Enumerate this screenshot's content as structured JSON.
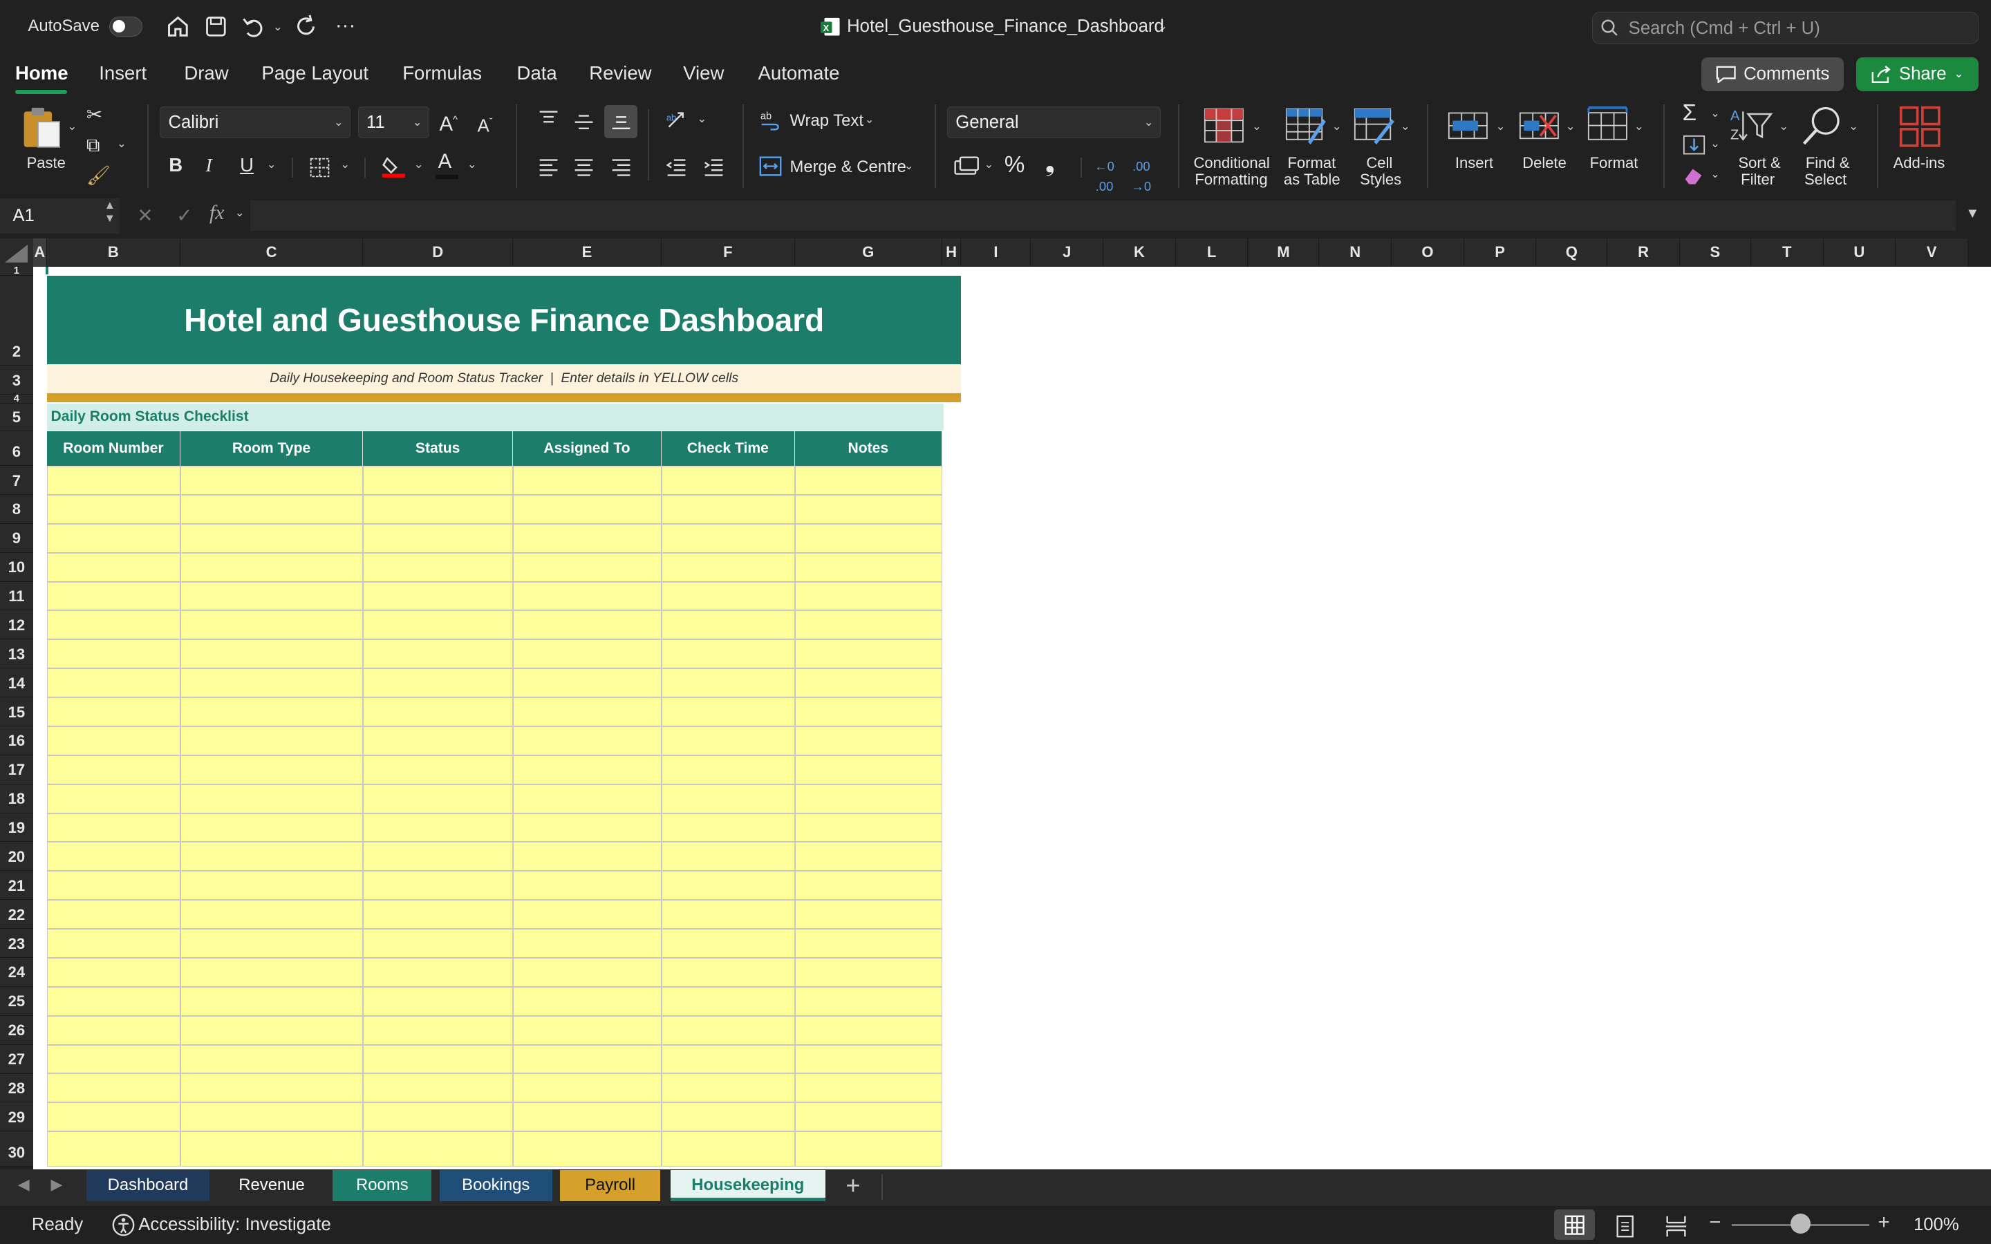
{
  "titlebar": {
    "autosave_label": "AutoSave",
    "autosave_on": false,
    "doc_title": "Hotel_Guesthouse_Finance_Dashboard",
    "search_placeholder": "Search (Cmd + Ctrl + U)"
  },
  "menu": {
    "tabs": [
      "Home",
      "Insert",
      "Draw",
      "Page Layout",
      "Formulas",
      "Data",
      "Review",
      "View",
      "Automate"
    ],
    "active": "Home",
    "comments_label": "Comments",
    "share_label": "Share"
  },
  "ribbon": {
    "paste_label": "Paste",
    "font_name": "Calibri",
    "font_size": "11",
    "wrap_text_label": "Wrap Text",
    "merge_label": "Merge & Centre",
    "number_format": "General",
    "conditional_formatting": [
      "Conditional",
      "Formatting"
    ],
    "format_as_table": [
      "Format",
      "as Table"
    ],
    "cell_styles": [
      "Cell",
      "Styles"
    ],
    "insert_label": "Insert",
    "delete_label": "Delete",
    "format_label": "Format",
    "sort_filter": [
      "Sort &",
      "Filter"
    ],
    "find_select": [
      "Find &",
      "Select"
    ],
    "addins_label": "Add-ins",
    "font_color": "#e00000",
    "fill_color": "#ff0000"
  },
  "formula_bar": {
    "name_box": "A1",
    "fx_label": "fx",
    "formula": ""
  },
  "grid": {
    "columns": [
      "A",
      "B",
      "C",
      "D",
      "E",
      "F",
      "G",
      "H",
      "I",
      "J",
      "K",
      "L",
      "M",
      "N",
      "O",
      "P",
      "Q",
      "R",
      "S",
      "T",
      "U",
      "V"
    ],
    "rows": [
      "1",
      "2",
      "3",
      "4",
      "5",
      "6",
      "7",
      "8",
      "9",
      "10",
      "11",
      "12",
      "13",
      "14",
      "15",
      "16",
      "17",
      "18",
      "19",
      "20",
      "21",
      "22",
      "23",
      "24",
      "25",
      "26",
      "27",
      "28",
      "29",
      "30"
    ]
  },
  "sheet": {
    "title": "Hotel and Guesthouse Finance Dashboard",
    "subtitle": "Daily Housekeeping and Room Status Tracker  |  Enter details in YELLOW cells",
    "section_title": "Daily Room Status Checklist",
    "table_headers": [
      "Room Number",
      "Room Type",
      "Status",
      "Assigned To",
      "Check Time",
      "Notes"
    ],
    "colors": {
      "title_bg": "#1c7d6b",
      "subtitle_bg": "#fdf2dc",
      "accent_bar": "#d4a02a",
      "section_bg": "#d1efe8",
      "section_text": "#1c7d6b",
      "header_bg": "#1c7d6b",
      "input_cell": "#ffff99"
    }
  },
  "sheet_tabs": [
    {
      "label": "Dashboard",
      "bg": "#213a5c",
      "fg": "#ffffff"
    },
    {
      "label": "Revenue",
      "bg": "#2a2a2a",
      "fg": "#ffffff"
    },
    {
      "label": "Rooms",
      "bg": "#1c7d6b",
      "fg": "#ffffff"
    },
    {
      "label": "Bookings",
      "bg": "#1f4e79",
      "fg": "#ffffff"
    },
    {
      "label": "Payroll",
      "bg": "#d4a02a",
      "fg": "#111111"
    },
    {
      "label": "Housekeeping",
      "bg": "#ffffff",
      "fg": "#1c7d6b",
      "active": true
    }
  ],
  "status_bar": {
    "ready": "Ready",
    "accessibility": "Accessibility: Investigate",
    "zoom": "100%",
    "zoom_level": 1.0
  }
}
